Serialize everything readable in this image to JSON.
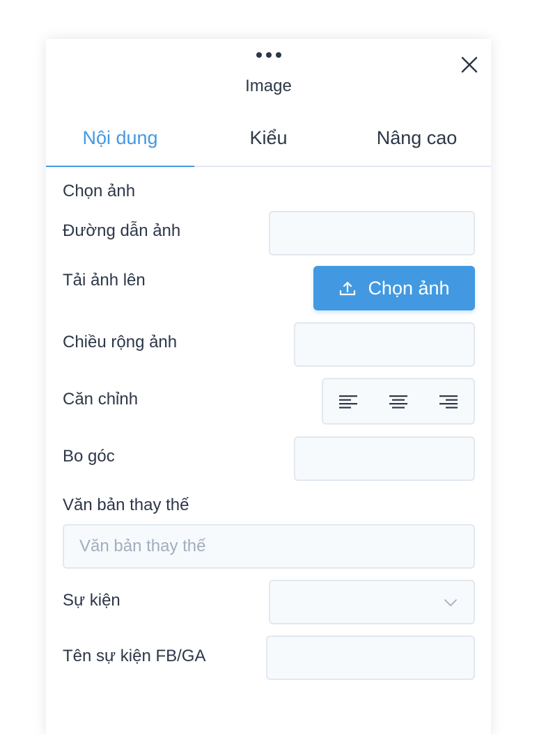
{
  "panel": {
    "title": "Image"
  },
  "tabs": [
    {
      "label": "Nội dung",
      "active": true
    },
    {
      "label": "Kiểu",
      "active": false
    },
    {
      "label": "Nâng cao",
      "active": false
    }
  ],
  "form": {
    "section_title": "Chọn ảnh",
    "image_url_label": "Đường dẫn ảnh",
    "image_url_value": "",
    "upload_label": "Tải ảnh lên",
    "upload_button": "Chọn ảnh",
    "width_label": "Chiều rộng ảnh",
    "width_value": "",
    "align_label": "Căn chỉnh",
    "align_options": [
      "align-left",
      "align-center",
      "align-right"
    ],
    "radius_label": "Bo góc",
    "radius_value": "",
    "alt_label": "Văn bản thay thế",
    "alt_placeholder": "Văn bản thay thế",
    "alt_value": "",
    "event_label": "Sự kiện",
    "event_value": "",
    "fbga_label": "Tên sự kiện FB/GA",
    "fbga_value": ""
  },
  "icons": {
    "drag": "more-horizontal-icon",
    "close": "close-icon",
    "upload": "upload-icon",
    "dropdown": "chevron-down-icon"
  },
  "colors": {
    "accent": "#4299e1",
    "text": "#2d3748",
    "placeholder": "#a0aec0",
    "field_bg": "#f7fafc",
    "field_border": "#e2e8f0"
  }
}
